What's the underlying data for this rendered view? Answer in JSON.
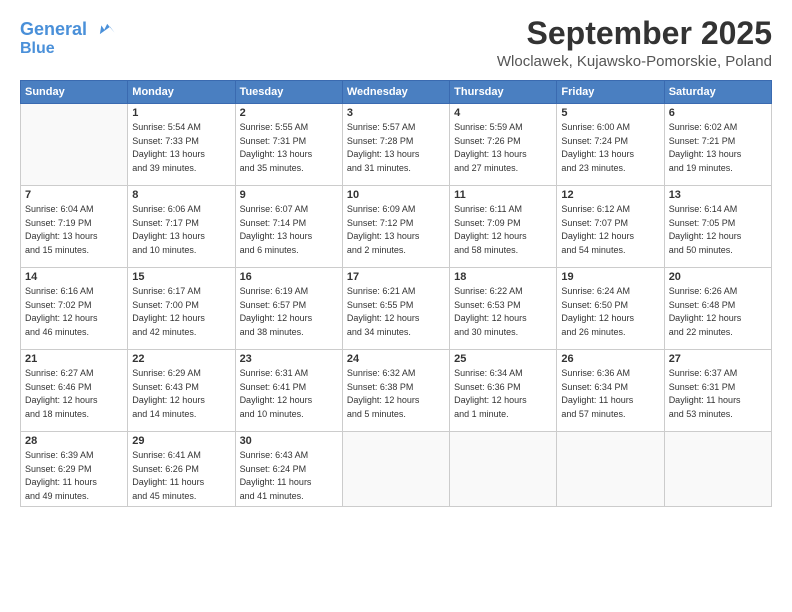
{
  "header": {
    "logo_line1": "General",
    "logo_line2": "Blue",
    "month": "September 2025",
    "location": "Wloclawek, Kujawsko-Pomorskie, Poland"
  },
  "weekdays": [
    "Sunday",
    "Monday",
    "Tuesday",
    "Wednesday",
    "Thursday",
    "Friday",
    "Saturday"
  ],
  "weeks": [
    [
      {
        "day": "",
        "info": ""
      },
      {
        "day": "1",
        "info": "Sunrise: 5:54 AM\nSunset: 7:33 PM\nDaylight: 13 hours\nand 39 minutes."
      },
      {
        "day": "2",
        "info": "Sunrise: 5:55 AM\nSunset: 7:31 PM\nDaylight: 13 hours\nand 35 minutes."
      },
      {
        "day": "3",
        "info": "Sunrise: 5:57 AM\nSunset: 7:28 PM\nDaylight: 13 hours\nand 31 minutes."
      },
      {
        "day": "4",
        "info": "Sunrise: 5:59 AM\nSunset: 7:26 PM\nDaylight: 13 hours\nand 27 minutes."
      },
      {
        "day": "5",
        "info": "Sunrise: 6:00 AM\nSunset: 7:24 PM\nDaylight: 13 hours\nand 23 minutes."
      },
      {
        "day": "6",
        "info": "Sunrise: 6:02 AM\nSunset: 7:21 PM\nDaylight: 13 hours\nand 19 minutes."
      }
    ],
    [
      {
        "day": "7",
        "info": "Sunrise: 6:04 AM\nSunset: 7:19 PM\nDaylight: 13 hours\nand 15 minutes."
      },
      {
        "day": "8",
        "info": "Sunrise: 6:06 AM\nSunset: 7:17 PM\nDaylight: 13 hours\nand 10 minutes."
      },
      {
        "day": "9",
        "info": "Sunrise: 6:07 AM\nSunset: 7:14 PM\nDaylight: 13 hours\nand 6 minutes."
      },
      {
        "day": "10",
        "info": "Sunrise: 6:09 AM\nSunset: 7:12 PM\nDaylight: 13 hours\nand 2 minutes."
      },
      {
        "day": "11",
        "info": "Sunrise: 6:11 AM\nSunset: 7:09 PM\nDaylight: 12 hours\nand 58 minutes."
      },
      {
        "day": "12",
        "info": "Sunrise: 6:12 AM\nSunset: 7:07 PM\nDaylight: 12 hours\nand 54 minutes."
      },
      {
        "day": "13",
        "info": "Sunrise: 6:14 AM\nSunset: 7:05 PM\nDaylight: 12 hours\nand 50 minutes."
      }
    ],
    [
      {
        "day": "14",
        "info": "Sunrise: 6:16 AM\nSunset: 7:02 PM\nDaylight: 12 hours\nand 46 minutes."
      },
      {
        "day": "15",
        "info": "Sunrise: 6:17 AM\nSunset: 7:00 PM\nDaylight: 12 hours\nand 42 minutes."
      },
      {
        "day": "16",
        "info": "Sunrise: 6:19 AM\nSunset: 6:57 PM\nDaylight: 12 hours\nand 38 minutes."
      },
      {
        "day": "17",
        "info": "Sunrise: 6:21 AM\nSunset: 6:55 PM\nDaylight: 12 hours\nand 34 minutes."
      },
      {
        "day": "18",
        "info": "Sunrise: 6:22 AM\nSunset: 6:53 PM\nDaylight: 12 hours\nand 30 minutes."
      },
      {
        "day": "19",
        "info": "Sunrise: 6:24 AM\nSunset: 6:50 PM\nDaylight: 12 hours\nand 26 minutes."
      },
      {
        "day": "20",
        "info": "Sunrise: 6:26 AM\nSunset: 6:48 PM\nDaylight: 12 hours\nand 22 minutes."
      }
    ],
    [
      {
        "day": "21",
        "info": "Sunrise: 6:27 AM\nSunset: 6:46 PM\nDaylight: 12 hours\nand 18 minutes."
      },
      {
        "day": "22",
        "info": "Sunrise: 6:29 AM\nSunset: 6:43 PM\nDaylight: 12 hours\nand 14 minutes."
      },
      {
        "day": "23",
        "info": "Sunrise: 6:31 AM\nSunset: 6:41 PM\nDaylight: 12 hours\nand 10 minutes."
      },
      {
        "day": "24",
        "info": "Sunrise: 6:32 AM\nSunset: 6:38 PM\nDaylight: 12 hours\nand 5 minutes."
      },
      {
        "day": "25",
        "info": "Sunrise: 6:34 AM\nSunset: 6:36 PM\nDaylight: 12 hours\nand 1 minute."
      },
      {
        "day": "26",
        "info": "Sunrise: 6:36 AM\nSunset: 6:34 PM\nDaylight: 11 hours\nand 57 minutes."
      },
      {
        "day": "27",
        "info": "Sunrise: 6:37 AM\nSunset: 6:31 PM\nDaylight: 11 hours\nand 53 minutes."
      }
    ],
    [
      {
        "day": "28",
        "info": "Sunrise: 6:39 AM\nSunset: 6:29 PM\nDaylight: 11 hours\nand 49 minutes."
      },
      {
        "day": "29",
        "info": "Sunrise: 6:41 AM\nSunset: 6:26 PM\nDaylight: 11 hours\nand 45 minutes."
      },
      {
        "day": "30",
        "info": "Sunrise: 6:43 AM\nSunset: 6:24 PM\nDaylight: 11 hours\nand 41 minutes."
      },
      {
        "day": "",
        "info": ""
      },
      {
        "day": "",
        "info": ""
      },
      {
        "day": "",
        "info": ""
      },
      {
        "day": "",
        "info": ""
      }
    ]
  ]
}
